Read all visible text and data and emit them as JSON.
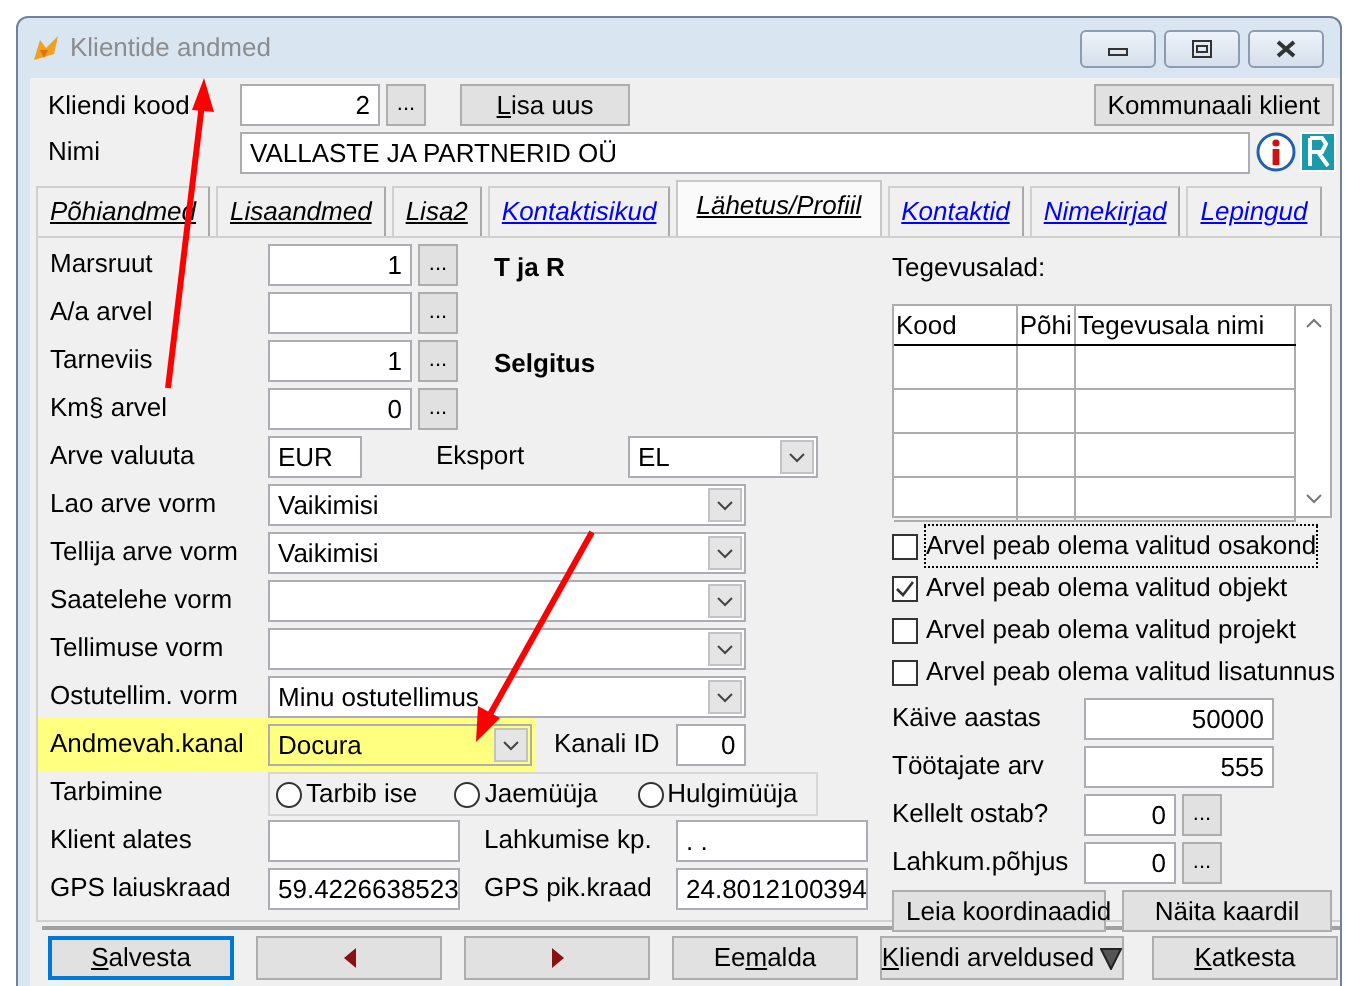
{
  "window": {
    "title": "Klientide andmed"
  },
  "header": {
    "code_label": "Kliendi kood",
    "code": "2",
    "code_button": "...",
    "add_button": {
      "accel": "L",
      "rest": "isa uus"
    },
    "utility_button": "Kommunaali klient",
    "name_label": "Nimi",
    "name": "VALLASTE JA PARTNERID OÜ"
  },
  "tabs": [
    {
      "label": "Põhiandmed",
      "kind": "plain",
      "selected": false
    },
    {
      "label": "Lisaandmed",
      "kind": "plain",
      "selected": false
    },
    {
      "label": "Lisa2",
      "kind": "plain",
      "selected": false
    },
    {
      "label": "Kontaktisikud",
      "kind": "link",
      "selected": false
    },
    {
      "label": "Lähetus/Profiil",
      "kind": "plain",
      "selected": true
    },
    {
      "label": "Kontaktid",
      "kind": "link",
      "selected": false
    },
    {
      "label": "Nimekirjad",
      "kind": "link",
      "selected": false
    },
    {
      "label": "Lepingud",
      "kind": "link",
      "selected": false
    }
  ],
  "fields": [
    {
      "kind": "lookup",
      "label": "Marsruut",
      "value": "1",
      "button": "...",
      "note": "T ja R"
    },
    {
      "kind": "lookup",
      "label": "A/a arvel",
      "button": "..."
    },
    {
      "kind": "lookup",
      "label": "Tarneviis",
      "value": "1",
      "button": "...",
      "note": "Selgitus"
    },
    {
      "kind": "lookup",
      "label": "Km§ arvel",
      "value": "0",
      "button": "..."
    },
    {
      "kind": "currency",
      "label": "Arve valuuta",
      "value": "EUR",
      "extra_label": "Eksport",
      "extra_value": "EL"
    },
    {
      "kind": "select",
      "label": "Lao arve vorm",
      "value": "Vaikimisi"
    },
    {
      "kind": "select",
      "label": "Tellija arve vorm",
      "value": "Vaikimisi"
    },
    {
      "kind": "select",
      "label": "Saatelehe vorm"
    },
    {
      "kind": "select",
      "label": "Tellimuse vorm"
    },
    {
      "kind": "select",
      "label": "Ostutellim. vorm",
      "value": "Minu ostutellimus"
    },
    {
      "kind": "channel",
      "label": "Andmevah.kanal",
      "value": "Docura",
      "highlighted": true,
      "extra_label": "Kanali ID",
      "extra_value": "0"
    },
    {
      "kind": "radios",
      "label": "Tarbimine",
      "options": [
        {
          "label": "Tarbib ise",
          "selected": false
        },
        {
          "label": "Jaemüüja",
          "selected": false
        },
        {
          "label": "Hulgimüüja",
          "selected": false
        }
      ]
    },
    {
      "kind": "pair",
      "label": "Klient alates",
      "extra_label": "Lahkumise kp.",
      "extra_value": ". ."
    },
    {
      "kind": "pair",
      "label": "GPS laiuskraad",
      "value": "59.4226638523",
      "extra_label": "GPS pik.kraad",
      "extra_value": "24.8012100394"
    }
  ],
  "activities": {
    "title": "Tegevusalad:",
    "columns": [
      "Kood",
      "Põhi",
      "Tegevusala nimi"
    ]
  },
  "checkboxes": [
    {
      "label": "Arvel peab olema valitud osakond",
      "checked": false,
      "focused": true
    },
    {
      "label": "Arvel peab olema valitud objekt",
      "checked": true,
      "focused": false
    },
    {
      "label": "Arvel peab olema valitud projekt",
      "checked": false,
      "focused": false
    },
    {
      "label": "Arvel peab olema valitud lisatunnus",
      "checked": false,
      "focused": false
    }
  ],
  "right_fields": [
    {
      "kind": "number",
      "label": "Käive aastas",
      "value": "50000"
    },
    {
      "kind": "number",
      "label": "Töötajate arv",
      "value": "555"
    },
    {
      "kind": "lookup",
      "label": "Kellelt ostab?",
      "value": "0",
      "button": "..."
    },
    {
      "kind": "lookup",
      "label": "Lahkum.põhjus",
      "value": "0",
      "button": "..."
    }
  ],
  "map_buttons": [
    "Leia koordinaadid",
    "Näita kaardil"
  ],
  "bottom_buttons": [
    {
      "kind": "text",
      "accel": "S",
      "rest": "alvesta",
      "focused": true
    },
    {
      "kind": "prev",
      "focused": false
    },
    {
      "kind": "next",
      "focused": false
    },
    {
      "kind": "text",
      "lead": "Ee",
      "accel": "m",
      "rest": "alda",
      "focused": false
    },
    {
      "kind": "menu",
      "accel": "K",
      "rest": "liendi arveldused",
      "focused": false
    },
    {
      "kind": "text",
      "accel": "K",
      "rest": "atkesta",
      "focused": false
    }
  ]
}
